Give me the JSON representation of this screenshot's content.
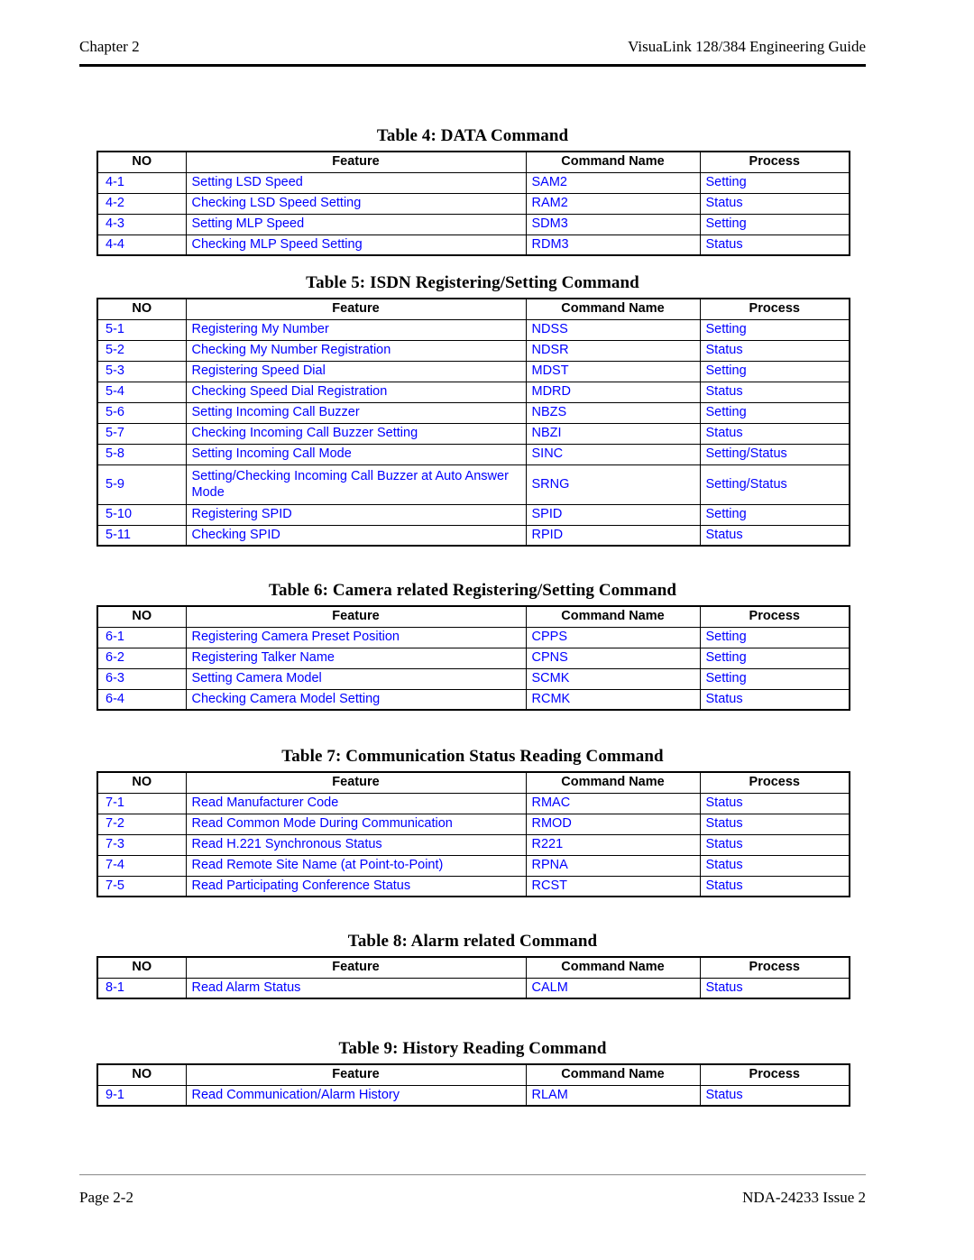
{
  "header": {
    "left": "Chapter 2",
    "right": "VisuaLink 128/384 Engineering Guide"
  },
  "footer": {
    "left": "Page 2-2",
    "right": "NDA-24233 Issue 2"
  },
  "colors": {
    "body_text": "#0000ff",
    "header_text": "#000000",
    "rule": "#000000"
  },
  "columns": [
    "NO",
    "Feature",
    "Command Name",
    "Process"
  ],
  "tables": [
    {
      "caption": "Table 4:  DATA Command",
      "headers": [
        "NO",
        "Feature",
        "Command Name",
        "Process"
      ],
      "rows": [
        [
          "4-1",
          "Setting LSD Speed",
          "SAM2",
          "Setting"
        ],
        [
          "4-2",
          "Checking LSD Speed Setting",
          "RAM2",
          "Status"
        ],
        [
          "4-3",
          "Setting MLP Speed",
          "SDM3",
          "Setting"
        ],
        [
          "4-4",
          "Checking MLP Speed Setting",
          "RDM3",
          "Status"
        ]
      ]
    },
    {
      "caption": "Table 5:  ISDN Registering/Setting Command",
      "headers": [
        "NO",
        "Feature",
        "Command Name",
        "Process"
      ],
      "rows": [
        [
          "5-1",
          "Registering My Number",
          "NDSS",
          "Setting"
        ],
        [
          "5-2",
          "Checking My Number Registration",
          "NDSR",
          "Status"
        ],
        [
          "5-3",
          "Registering Speed Dial",
          "MDST",
          "Setting"
        ],
        [
          "5-4",
          "Checking Speed Dial Registration",
          "MDRD",
          "Status"
        ],
        [
          "5-6",
          "Setting Incoming Call Buzzer",
          "NBZS",
          "Setting"
        ],
        [
          "5-7",
          "Checking Incoming Call Buzzer Setting",
          "NBZI",
          "Status"
        ],
        [
          "5-8",
          "Setting Incoming Call Mode",
          "SINC",
          "Setting/Status"
        ],
        [
          "5-9",
          "Setting/Checking Incoming Call Buzzer at Auto Answer Mode",
          "SRNG",
          "Setting/Status"
        ],
        [
          "5-10",
          "Registering SPID",
          "SPID",
          "Setting"
        ],
        [
          "5-11",
          "Checking SPID",
          "RPID",
          "Status"
        ]
      ]
    },
    {
      "caption": "Table 6:  Camera related Registering/Setting Command",
      "headers": [
        "NO",
        "Feature",
        "Command Name",
        "Process"
      ],
      "rows": [
        [
          "6-1",
          "Registering Camera Preset Position",
          "CPPS",
          "Setting"
        ],
        [
          "6-2",
          "Registering Talker Name",
          "CPNS",
          "Setting"
        ],
        [
          "6-3",
          "Setting Camera Model",
          "SCMK",
          "Setting"
        ],
        [
          "6-4",
          "Checking Camera Model Setting",
          "RCMK",
          "Status"
        ]
      ]
    },
    {
      "caption": "Table 7:  Communication Status Reading Command",
      "headers": [
        "NO",
        "Feature",
        "Command Name",
        "Process"
      ],
      "rows": [
        [
          "7-1",
          "Read Manufacturer Code",
          "RMAC",
          "Status"
        ],
        [
          "7-2",
          "Read Common Mode During Communication",
          "RMOD",
          "Status"
        ],
        [
          "7-3",
          "Read H.221 Synchronous Status",
          "R221",
          "Status"
        ],
        [
          "7-4",
          "Read Remote Site Name (at Point-to-Point)",
          "RPNA",
          "Status"
        ],
        [
          "7-5",
          "Read Participating Conference Status",
          "RCST",
          "Status"
        ]
      ]
    },
    {
      "caption": "Table 8:  Alarm related Command",
      "headers": [
        "NO",
        "Feature",
        "Command Name",
        "Process"
      ],
      "rows": [
        [
          "8-1",
          "Read Alarm Status",
          "CALM",
          "Status"
        ]
      ]
    },
    {
      "caption": "Table 9:  History Reading Command",
      "headers": [
        "NO",
        "Feature",
        "Command Name",
        "Process"
      ],
      "rows": [
        [
          "9-1",
          "Read Communication/Alarm History",
          "RLAM",
          "Status"
        ]
      ]
    }
  ]
}
